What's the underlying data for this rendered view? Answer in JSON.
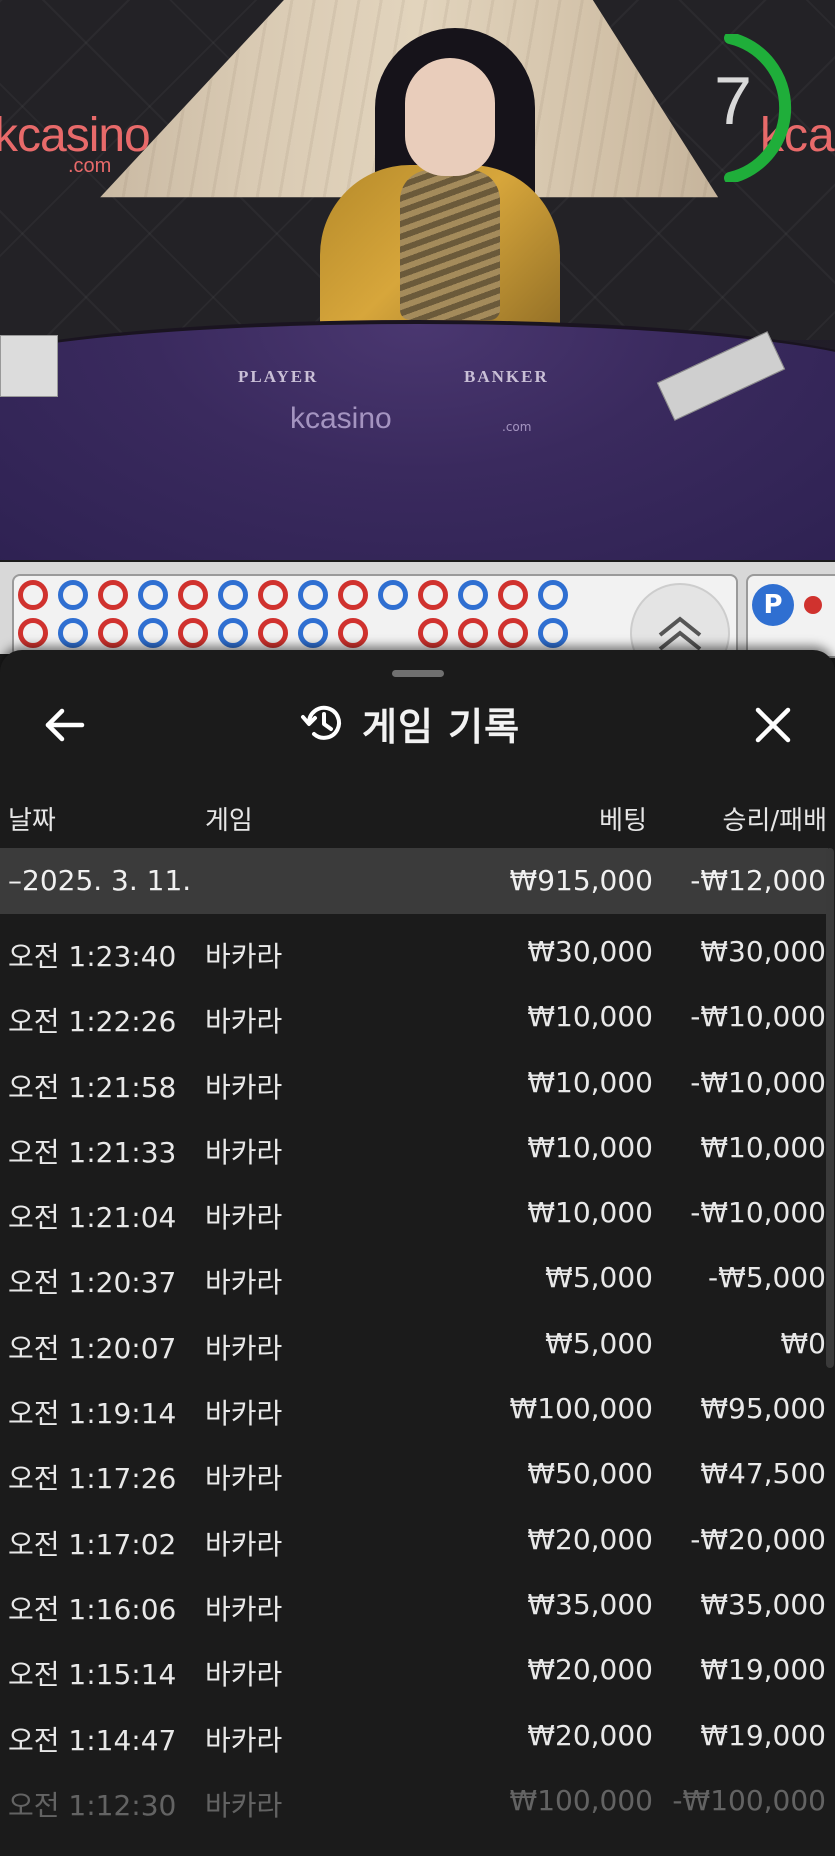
{
  "video": {
    "brand_left": "kcasino",
    "brand_left_sub": ".com",
    "brand_right": "kca",
    "felt_player": "PLAYER",
    "felt_banker": "BANKER",
    "felt_logo": "kcasino",
    "felt_logo_sub": ".com",
    "timer_value": "7"
  },
  "roadmap": {
    "badge": "P"
  },
  "sheet": {
    "title": "게임 기록",
    "back_icon": "arrow-left-icon",
    "history_icon": "history-clock-icon",
    "close_icon": "close-x-icon",
    "columns": {
      "date": "날짜",
      "game": "게임",
      "bet": "베팅",
      "result": "승리/패배"
    },
    "summary": {
      "date": "–2025. 3. 11.",
      "bet": "₩915,000",
      "result": "-₩12,000"
    },
    "rows": [
      {
        "time": "오전 1:23:40",
        "game": "바카라",
        "bet": "₩30,000",
        "result": "₩30,000"
      },
      {
        "time": "오전 1:22:26",
        "game": "바카라",
        "bet": "₩10,000",
        "result": "-₩10,000"
      },
      {
        "time": "오전 1:21:58",
        "game": "바카라",
        "bet": "₩10,000",
        "result": "-₩10,000"
      },
      {
        "time": "오전 1:21:33",
        "game": "바카라",
        "bet": "₩10,000",
        "result": "₩10,000"
      },
      {
        "time": "오전 1:21:04",
        "game": "바카라",
        "bet": "₩10,000",
        "result": "-₩10,000"
      },
      {
        "time": "오전 1:20:37",
        "game": "바카라",
        "bet": "₩5,000",
        "result": "-₩5,000"
      },
      {
        "time": "오전 1:20:07",
        "game": "바카라",
        "bet": "₩5,000",
        "result": "₩0"
      },
      {
        "time": "오전 1:19:14",
        "game": "바카라",
        "bet": "₩100,000",
        "result": "₩95,000"
      },
      {
        "time": "오전 1:17:26",
        "game": "바카라",
        "bet": "₩50,000",
        "result": "₩47,500"
      },
      {
        "time": "오전 1:17:02",
        "game": "바카라",
        "bet": "₩20,000",
        "result": "-₩20,000"
      },
      {
        "time": "오전 1:16:06",
        "game": "바카라",
        "bet": "₩35,000",
        "result": "₩35,000"
      },
      {
        "time": "오전 1:15:14",
        "game": "바카라",
        "bet": "₩20,000",
        "result": "₩19,000"
      },
      {
        "time": "오전 1:14:47",
        "game": "바카라",
        "bet": "₩20,000",
        "result": "₩19,000"
      },
      {
        "time": "오전 1:12:30",
        "game": "바카라",
        "bet": "₩100,000",
        "result": "-₩100,000"
      }
    ]
  },
  "colors": {
    "sheet_bg": "#1b1b1b",
    "summary_bg": "#3b3b3b",
    "road_red": "#d0322e",
    "road_blue": "#2f6fd1",
    "timer_green": "#1fae3a"
  }
}
